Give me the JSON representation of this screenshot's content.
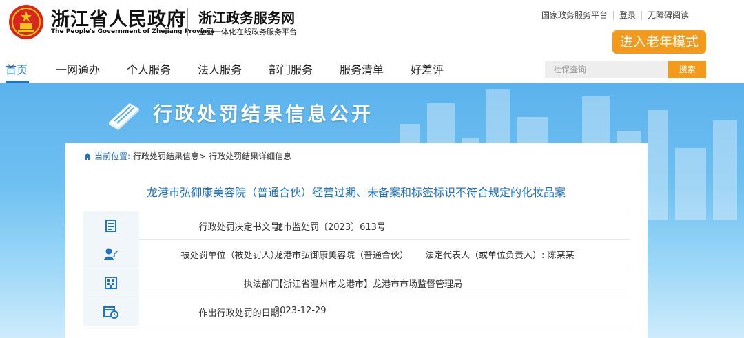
{
  "header": {
    "gov_name_cn": "浙江省人民政府",
    "gov_name_en": "The People's Government of Zhejiang Province",
    "service_name": "浙江政务服务网",
    "service_sub": "全国一体化在线政务服务平台",
    "top_links": [
      "国家政务服务平台",
      "登录",
      "无障碍阅读"
    ],
    "elder_mode": "进入老年模式"
  },
  "nav": {
    "items": [
      "首页",
      "一网通办",
      "个人服务",
      "法人服务",
      "部门服务",
      "服务清单",
      "好差评"
    ],
    "active_index": 0
  },
  "search": {
    "placeholder": "社保查询",
    "button": "搜索"
  },
  "banner": {
    "title": "行政处罚结果信息公开"
  },
  "breadcrumb": {
    "prefix": "当前位置:",
    "items": [
      "行政处罚结果信息>",
      "行政处罚结果详细信息"
    ]
  },
  "case": {
    "title": "龙港市弘御康美容院（普通合伙）经营过期、未备案和标签标识不符合规定的化妆品案",
    "rows": [
      {
        "icon": "document-icon",
        "label": "行政处罚决定书文号:",
        "value": "龙市监处罚〔2023〕613号"
      },
      {
        "icon": "person-icon",
        "label": "被处罚单位（被处罚人）:",
        "value": "龙港市弘御康美容院（普通合伙）",
        "label2": "法定代表人（或单位负责人）:",
        "value2": "陈某某"
      },
      {
        "icon": "building-icon",
        "label": "执法部门:",
        "value": "【浙江省温州市龙港市】龙港市市场监督管理局"
      },
      {
        "icon": "calendar-icon",
        "label": "作出行政处罚的日期:",
        "value": "2023-12-29"
      }
    ]
  },
  "colors": {
    "accent": "#1e73c6",
    "orange": "#f39a1c",
    "emblem_red": "#d7261c"
  }
}
